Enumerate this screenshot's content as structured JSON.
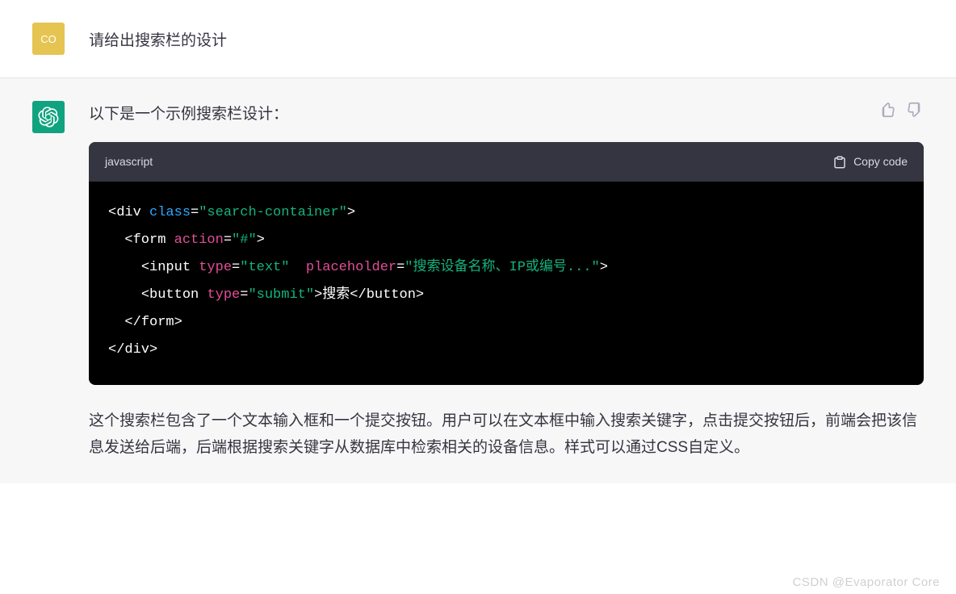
{
  "user": {
    "avatar_label": "CO",
    "message": "请给出搜索栏的设计"
  },
  "assistant": {
    "intro": "以下是一个示例搜索栏设计：",
    "code_lang": "javascript",
    "copy_label": "Copy code",
    "code": {
      "l1_open_lt": "<",
      "l1_tag_div": "div",
      "l1_attr_class": "class",
      "l1_eq_q": "=",
      "l1_val": "\"search-container\"",
      "l1_close_gt": ">",
      "l2_indent": "  ",
      "l2_lt": "<",
      "l2_tag_form": "form",
      "l2_attr_action": "action",
      "l2_eq": "=",
      "l2_val": "\"#\"",
      "l2_gt": ">",
      "l3_indent": "    ",
      "l3_lt": "<",
      "l3_tag_input": "input",
      "l3_attr_type": "type",
      "l3_eq1": "=",
      "l3_val_text": "\"text\"",
      "l3_sp": " ",
      "l3_attr_ph": "placeholder",
      "l3_eq2": "=",
      "l3_val_ph": "\"搜索设备名称、IP或编号...\"",
      "l3_gt": ">",
      "l4_indent": "    ",
      "l4_lt": "<",
      "l4_tag_button": "button",
      "l4_attr_type": "type",
      "l4_eq": "=",
      "l4_val_submit": "\"submit\"",
      "l4_gt": ">",
      "l4_text": "搜索",
      "l4_close_lt": "</",
      "l4_close_tag": "button",
      "l4_close_gt": ">",
      "l5_indent": "  ",
      "l5_close_form": "</",
      "l5_tag": "form",
      "l5_gt": ">",
      "l6_close_div": "</",
      "l6_tag": "div",
      "l6_gt": ">"
    },
    "explanation": "这个搜索栏包含了一个文本输入框和一个提交按钮。用户可以在文本框中输入搜索关键字，点击提交按钮后，前端会把该信息发送给后端，后端根据搜索关键字从数据库中检索相关的设备信息。样式可以通过CSS自定义。"
  },
  "watermark": "CSDN @Evaporator Core"
}
